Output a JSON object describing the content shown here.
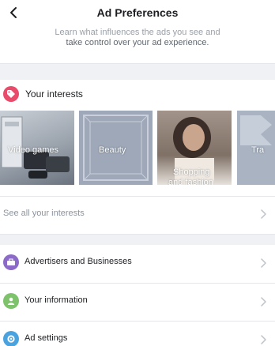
{
  "header": {
    "title": "Ad Preferences",
    "back_icon": "chevron-left-icon"
  },
  "intro": {
    "line1": "Learn what influences the ads you see and",
    "line2": "take control over your ad experience."
  },
  "interests": {
    "title": "Your interests",
    "icon": "tag-icon",
    "icon_color": "#e94b6a",
    "cards": [
      {
        "label_lines": [
          "Video games"
        ]
      },
      {
        "label_lines": [
          "Beauty"
        ]
      },
      {
        "label_lines": [
          "Shopping",
          "and fashion"
        ]
      },
      {
        "label_lines": [
          "Tra"
        ]
      }
    ],
    "see_all": "See all your interests"
  },
  "menu": [
    {
      "label": "Advertisers and Businesses",
      "icon": "briefcase-icon",
      "color": "#8c6bc8"
    },
    {
      "label": "Your information",
      "icon": "person-icon",
      "color": "#7ec26b"
    },
    {
      "label": "Ad settings",
      "icon": "gear-icon",
      "color": "#4aa3df"
    }
  ]
}
